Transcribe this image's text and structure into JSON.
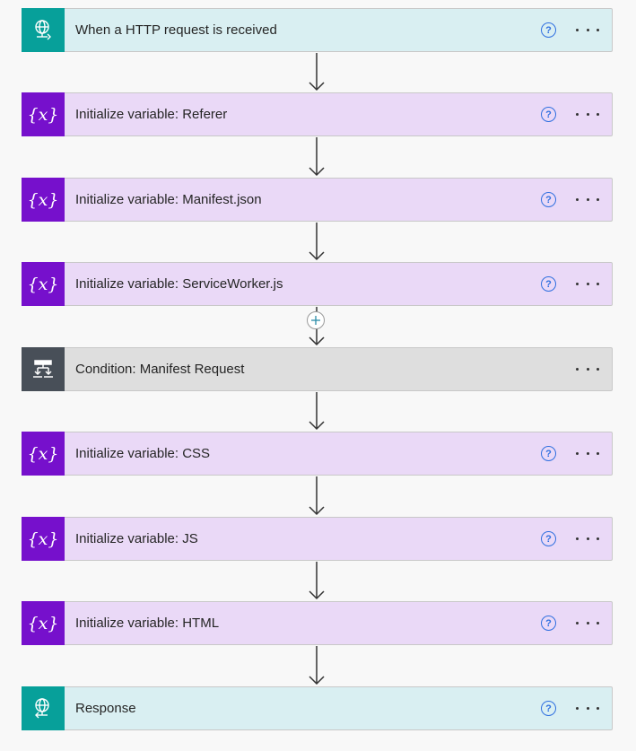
{
  "steps": [
    {
      "title": "When a HTTP request is received",
      "type": "http",
      "icon": "globe-network-icon",
      "help": "?"
    },
    {
      "title": "Initialize variable: Referer",
      "type": "var",
      "icon": "variable-icon",
      "help": "?"
    },
    {
      "title": "Initialize variable: Manifest.json",
      "type": "var",
      "icon": "variable-icon",
      "help": "?"
    },
    {
      "title": "Initialize variable: ServiceWorker.js",
      "type": "var",
      "icon": "variable-icon",
      "help": "?"
    },
    {
      "title": "Condition: Manifest Request",
      "type": "cond",
      "icon": "condition-icon"
    },
    {
      "title": "Initialize variable: CSS",
      "type": "var",
      "icon": "variable-icon",
      "help": "?"
    },
    {
      "title": "Initialize variable: JS",
      "type": "var",
      "icon": "variable-icon",
      "help": "?"
    },
    {
      "title": "Initialize variable: HTML",
      "type": "var",
      "icon": "variable-icon",
      "help": "?"
    },
    {
      "title": "Response",
      "type": "http",
      "icon": "globe-network-icon",
      "help": "?"
    }
  ],
  "colors": {
    "http_bg": "#d9eff2",
    "http_icon": "#07a09a",
    "var_bg": "#ead9f7",
    "var_icon": "#7610cc",
    "cond_bg": "#dedede",
    "cond_icon": "#484f58",
    "help": "#2f6fe0"
  }
}
